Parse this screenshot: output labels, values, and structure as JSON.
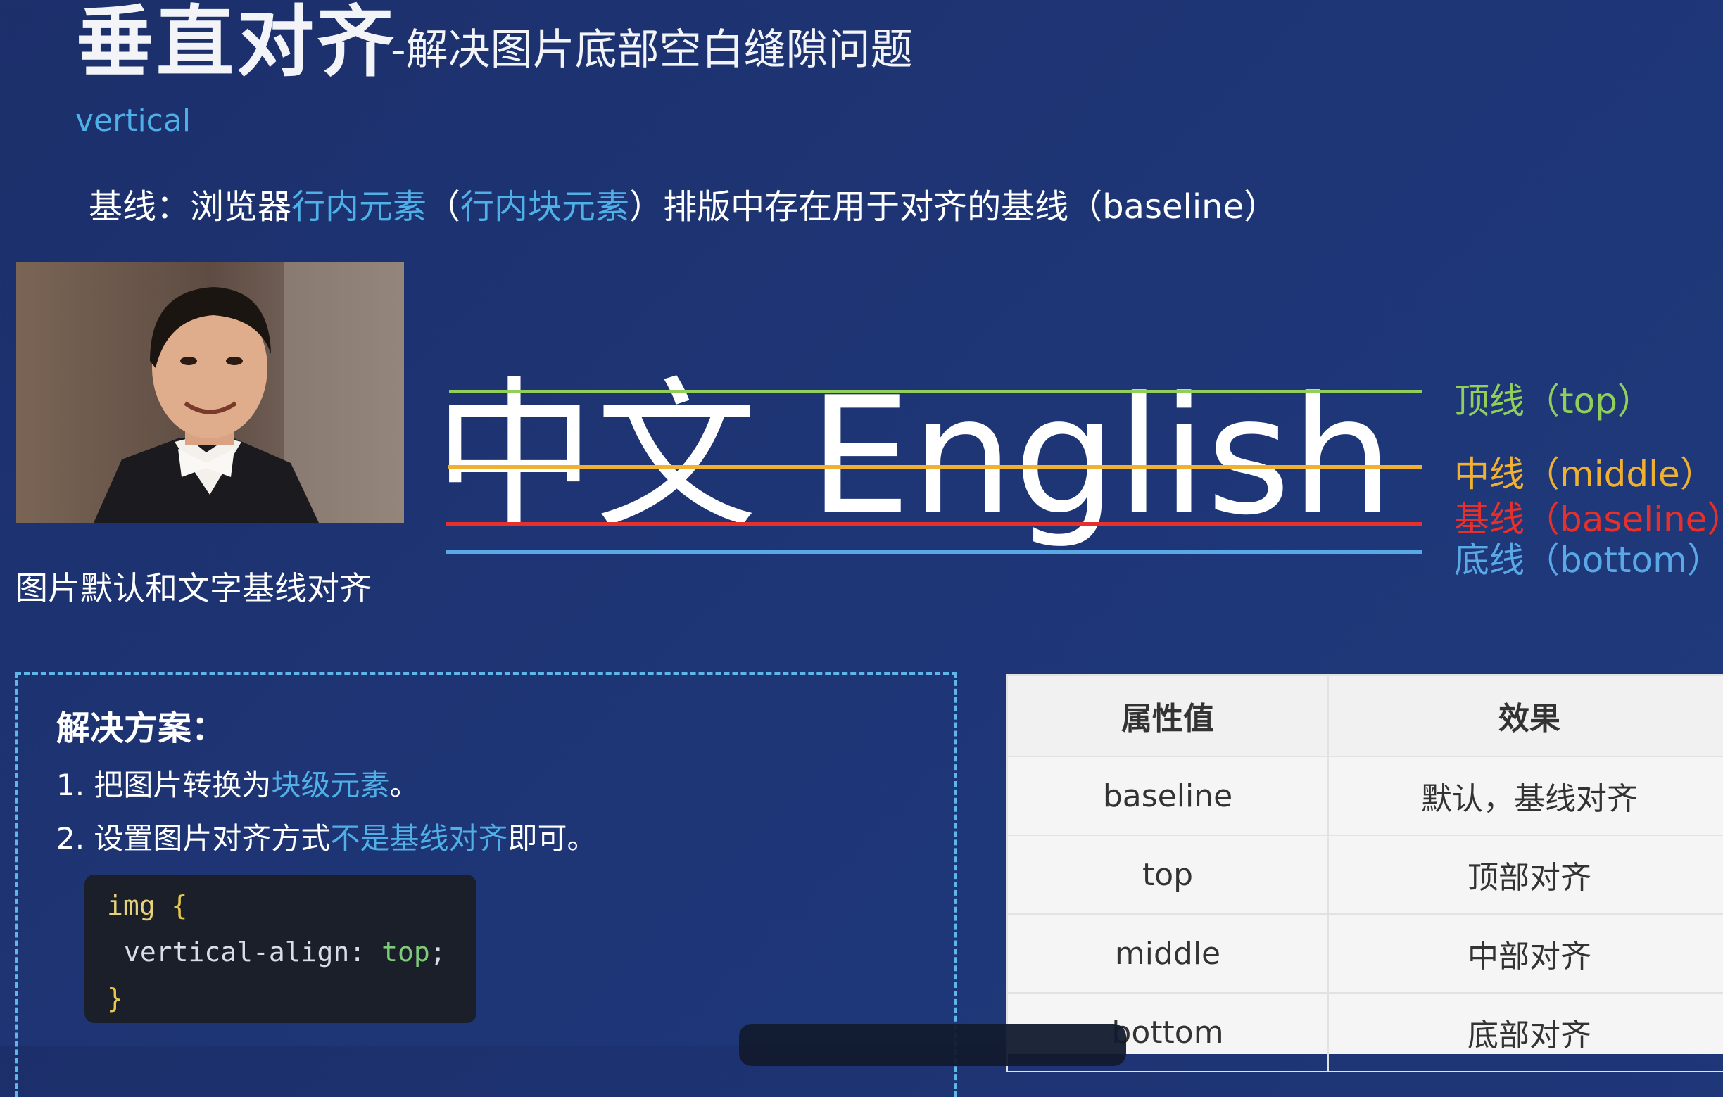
{
  "header": {
    "title_main": "垂直对齐",
    "title_sub": "-解决图片底部空白缝隙问题",
    "property_name": "vertical"
  },
  "baseline_definition": {
    "prefix": "基线：浏览器",
    "term1": "行内元素",
    "paren_open": "（",
    "term2": "行内块元素",
    "suffix": "）排版中存在用于对齐的基线（baseline）"
  },
  "photo": {
    "caption": "图片默认和文字基线对齐"
  },
  "demo": {
    "text": "中文 English",
    "lines": [
      {
        "label": "顶线（top）",
        "color": "#8fcf5a"
      },
      {
        "label": "中线（middle）",
        "color": "#f0b132"
      },
      {
        "label": "基线（baseline）",
        "color": "#e5302c"
      },
      {
        "label": "底线（bottom）",
        "color": "#5aa8e6"
      }
    ]
  },
  "solution": {
    "title": "解决方案：",
    "step1_prefix": "1. 把图片转换为",
    "step1_highlight": "块级元素",
    "step1_suffix": "。",
    "step2_prefix": "2. 设置图片对齐方式",
    "step2_highlight": "不是基线对齐",
    "step2_suffix": "即可。",
    "code": {
      "selector": "img",
      "open_brace": "{",
      "property": "vertical-align",
      "colon": ":",
      "value": "top",
      "semicolon": ";",
      "close_brace": "}"
    }
  },
  "table": {
    "headers": [
      "属性值",
      "效果"
    ],
    "rows": [
      [
        "baseline",
        "默认，基线对齐"
      ],
      [
        "top",
        "顶部对齐"
      ],
      [
        "middle",
        "中部对齐"
      ],
      [
        "bottom",
        "底部对齐"
      ]
    ]
  },
  "colors": {
    "background": "#1e3575",
    "highlight": "#4fb0e8",
    "top_line": "#8fcf5a",
    "middle_line": "#f0b132",
    "baseline_line": "#e5302c",
    "bottom_line": "#5aa8e6"
  }
}
